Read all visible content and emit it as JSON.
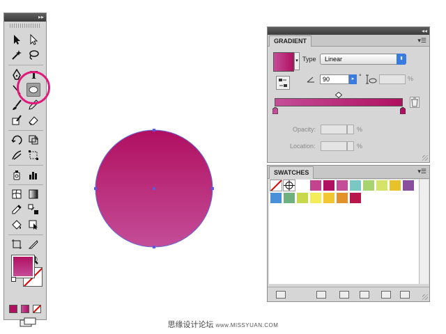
{
  "gradient_panel": {
    "tab_title": "GRADIENT",
    "type_label": "Type",
    "type_value": "Linear",
    "angle_value": "90",
    "angle_unit": "°",
    "aspect_unit": "%",
    "opacity_label": "Opacity:",
    "opacity_unit": "%",
    "location_label": "Location:",
    "location_unit": "%",
    "start_color": "#c44d98",
    "end_color": "#b01060"
  },
  "swatches_panel": {
    "tab_title": "SWATCHES",
    "row1": [
      "#ffffff",
      "#ffffff",
      "#ffffff",
      "#c2448e",
      "#b01060",
      "#c44d98",
      "#7bc7c4",
      "#a7d46f",
      "#d4e36a",
      "#e8c22a",
      "#8a4f9c"
    ],
    "row2": [
      "#4a90d9",
      "#6fb07f",
      "#c7d84a",
      "#f5ec5a",
      "#f2c631",
      "#e3922b",
      "#b8174c"
    ]
  },
  "tools": {
    "fill_color": "#b01060"
  },
  "caption": {
    "text": "思缘设计论坛",
    "url": "www.MISSYUAN.COM"
  }
}
